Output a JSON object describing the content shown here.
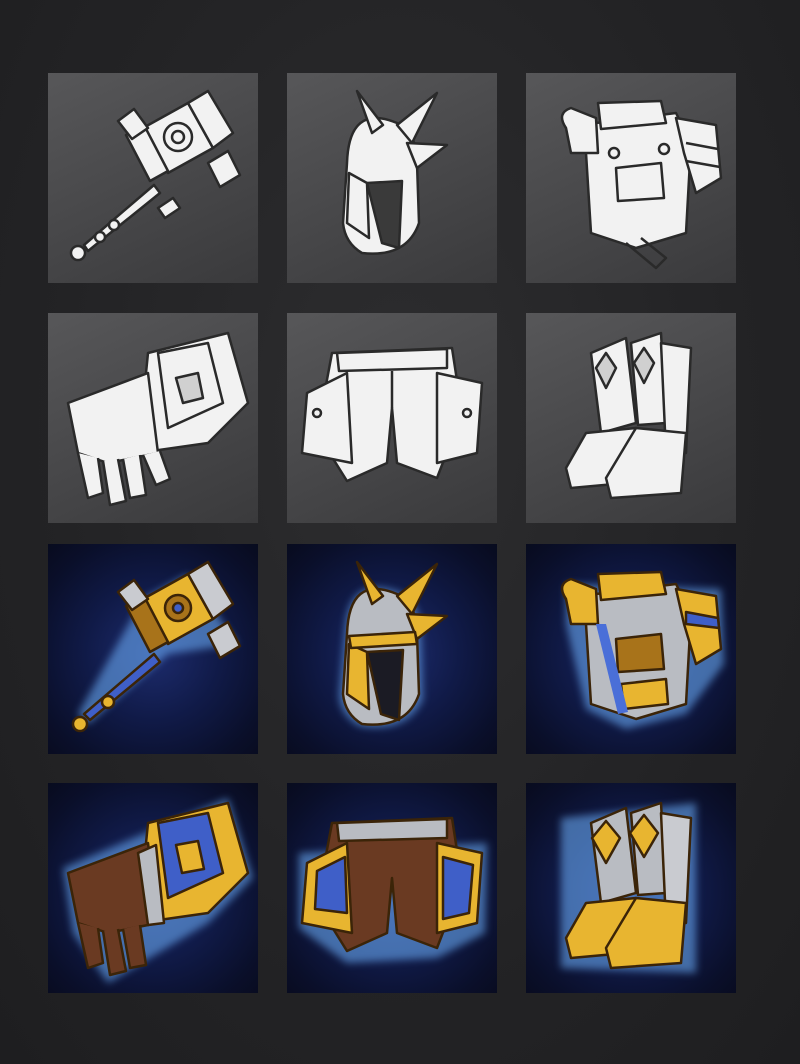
{
  "sheet": {
    "sketch_tiles": [
      {
        "item": "hammer",
        "icon": "hammer-sketch-icon"
      },
      {
        "item": "helmet",
        "icon": "helmet-sketch-icon"
      },
      {
        "item": "chest-armor",
        "icon": "chest-armor-sketch-icon"
      },
      {
        "item": "gauntlet",
        "icon": "gauntlet-sketch-icon"
      },
      {
        "item": "leg-armor",
        "icon": "leg-armor-sketch-icon"
      },
      {
        "item": "boots",
        "icon": "boots-sketch-icon"
      }
    ],
    "painted_tiles": [
      {
        "item": "hammer",
        "icon": "hammer-icon"
      },
      {
        "item": "helmet",
        "icon": "helmet-icon"
      },
      {
        "item": "chest-armor",
        "icon": "chest-armor-icon"
      },
      {
        "item": "gauntlet",
        "icon": "gauntlet-icon"
      },
      {
        "item": "leg-armor",
        "icon": "leg-armor-icon"
      },
      {
        "item": "boots",
        "icon": "boots-icon"
      }
    ]
  },
  "colors": {
    "page_bg": "#252527",
    "sketch_tile_bg": "#4a4a4c",
    "sketch_fill": "#f2f2f2",
    "sketch_line": "#2a2a2a",
    "painted_tile_bg": "#101a47",
    "gold": "#e8b530",
    "gold_dark": "#a8731a",
    "steel": "#b9bcc2",
    "blue_trim": "#3f5fc8",
    "glow": "#6fb4ff",
    "leather": "#6a3a22"
  }
}
